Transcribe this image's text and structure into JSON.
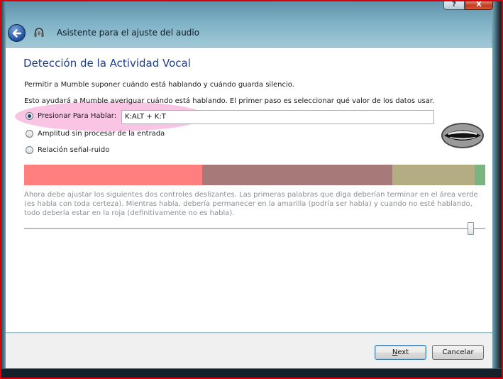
{
  "window": {
    "title": "Asistente para el ajuste del audio",
    "help_label": "?",
    "close_label": "X"
  },
  "page": {
    "heading": "Detección de la Actividad Vocal",
    "description_1": "Permitir a Mumble suponer cuándo está hablando y cuándo guarda silencio.",
    "description_2": "Esto ayudará a Mumble averiguar cuándo está hablando. El primer paso es seleccionar qué valor de los datos usar."
  },
  "options": [
    {
      "label": "Presionar Para Hablar:",
      "selected": true
    },
    {
      "label": "Amplitud sin procesar de la entrada",
      "selected": false
    },
    {
      "label": "Relación señal-ruido",
      "selected": false
    }
  ],
  "shortcut": {
    "value": "K:ALT + K:T"
  },
  "level_colors": {
    "silence": "#ff7f7f",
    "unsure": "#a67a78",
    "maybe_speech": "#b4ac82",
    "speech": "#7ab581"
  },
  "instructions": "Ahora debe ajustar los siguientes dos controles deslizantes. Las primeras palabras que diga deberían terminar en el área verde (es habla con toda certeza). Mientras habla, debería permanecer en la amarilla (podría ser habla) y cuando no esté hablando, todo debería estar en la roja (definitivamente no es habla).",
  "slider": {
    "value_fraction": 0.96
  },
  "buttons": {
    "next_mnemonic": "N",
    "next_rest": "ext",
    "cancel": "Cancelar"
  },
  "icons": {
    "back": "back-arrow-icon",
    "app": "mumble-headset-icon",
    "mouth": "mouth-icon"
  }
}
